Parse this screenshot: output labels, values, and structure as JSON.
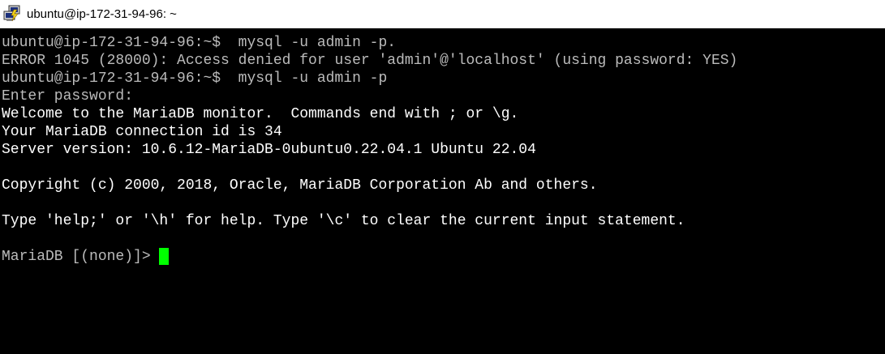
{
  "window": {
    "title": "ubuntu@ip-172-31-94-96: ~",
    "icon": "putty-terminal-icon"
  },
  "terminal": {
    "colors": {
      "background": "#000000",
      "normal_text": "#bbbbbb",
      "bright_text": "#ffffff",
      "cursor": "#00ff00"
    },
    "lines": [
      "ubuntu@ip-172-31-94-96:~$  mysql -u admin -p.",
      "ERROR 1045 (28000): Access denied for user 'admin'@'localhost' (using password: YES)",
      "ubuntu@ip-172-31-94-96:~$  mysql -u admin -p",
      "Enter password:",
      "Welcome to the MariaDB monitor.  Commands end with ; or \\g.",
      "Your MariaDB connection id is 34",
      "Server version: 10.6.12-MariaDB-0ubuntu0.22.04.1 Ubuntu 22.04",
      "",
      "Copyright (c) 2000, 2018, Oracle, MariaDB Corporation Ab and others.",
      "",
      "Type 'help;' or '\\h' for help. Type '\\c' to clear the current input statement.",
      "",
      "MariaDB [(none)]>"
    ]
  }
}
